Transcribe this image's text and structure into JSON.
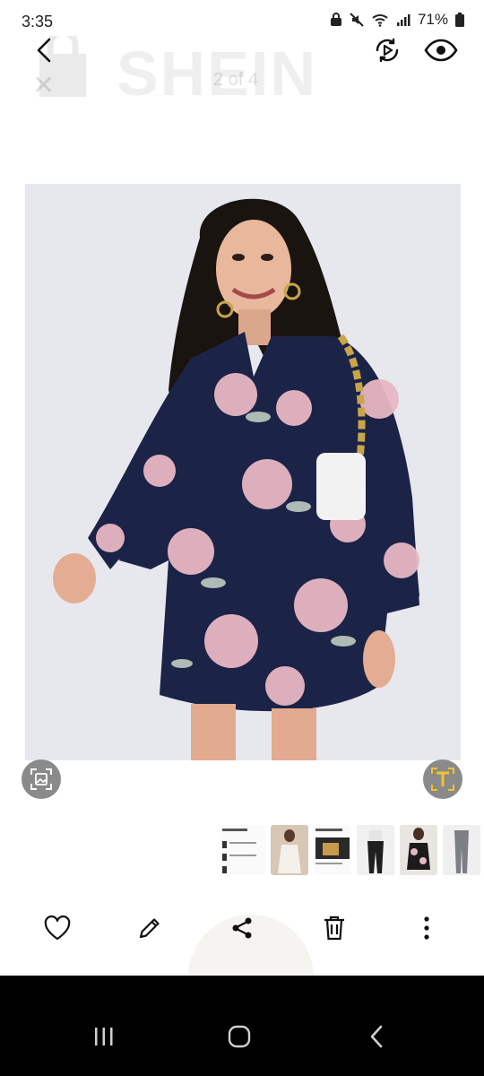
{
  "status_bar": {
    "time": "3:35",
    "battery": "71%",
    "icons": [
      "lock-icon",
      "mute-icon",
      "wifi-icon",
      "signal-icon",
      "battery-icon"
    ]
  },
  "top_bar": {
    "watermark_brand": "SHEIN",
    "faded_counter": "2 of 4",
    "icons": [
      "back-icon",
      "motion-photo-icon",
      "eye-icon"
    ]
  },
  "image": {
    "subject": "floral navy dress"
  },
  "action_buttons": [
    "gallery-scan-icon",
    "extract-text-icon"
  ],
  "thumbnails": [
    "thumb-1",
    "thumb-2",
    "thumb-3",
    "thumb-4",
    "thumb-5",
    "thumb-6",
    "thumb-7"
  ],
  "toolbar": [
    "favorite-icon",
    "edit-icon",
    "share-icon",
    "delete-icon",
    "more-icon"
  ],
  "nav_bar": [
    "recent-apps-icon",
    "home-icon",
    "back-nav-icon"
  ],
  "colors": {
    "dress": "#1b2347",
    "flower": "#e8b7c3",
    "background_photo": "#e7e8ee",
    "text_button": "#f2c230"
  }
}
